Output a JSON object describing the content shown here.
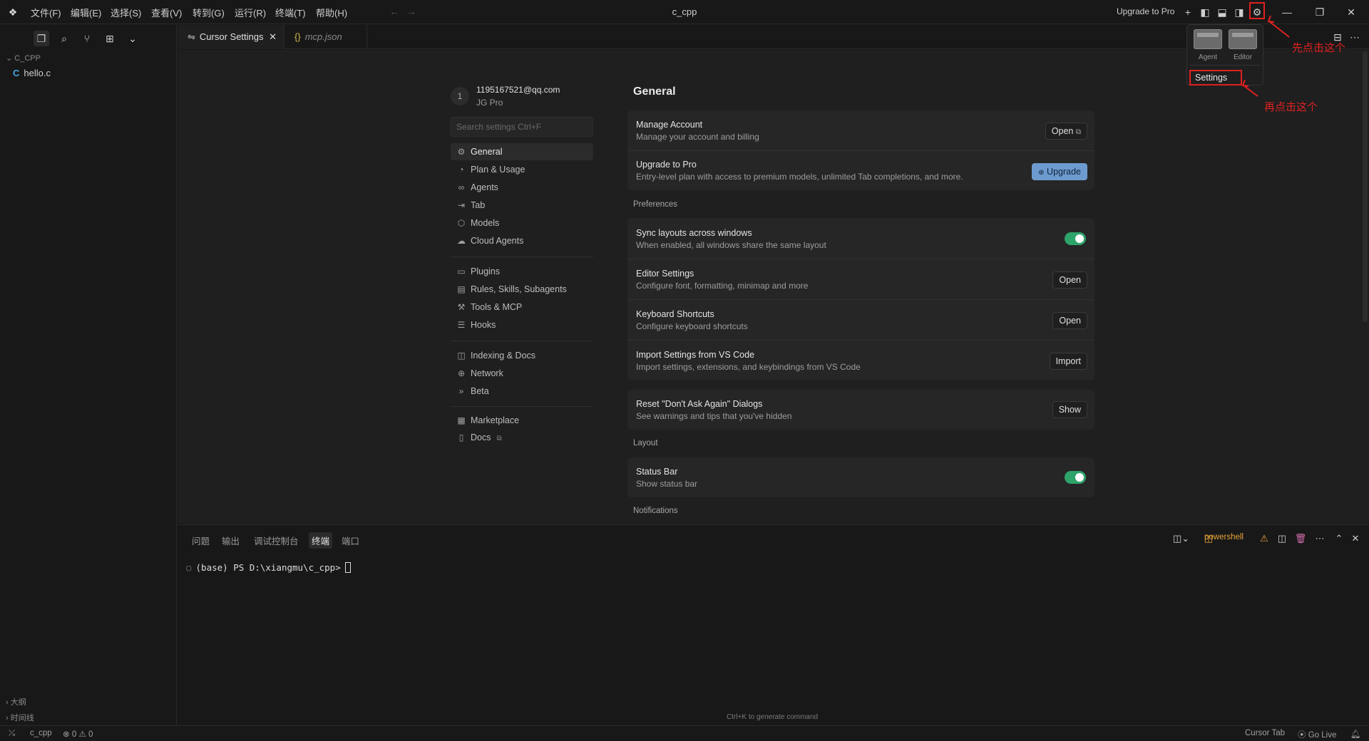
{
  "titlebar": {
    "menu": [
      "文件(F)",
      "编辑(E)",
      "选择(S)",
      "查看(V)",
      "转到(G)",
      "运行(R)",
      "终端(T)",
      "帮助(H)"
    ],
    "title": "c_cpp",
    "upgrade_label": "Upgrade to Pro"
  },
  "sidebar": {
    "root": "C_CPP",
    "files": [
      {
        "name": "hello.c",
        "icon": "C"
      }
    ],
    "bottom": [
      "大纲",
      "时间线"
    ]
  },
  "tabs": [
    {
      "label": "Cursor Settings",
      "icon": "settings-icon"
    },
    {
      "label": "mcp.json",
      "icon": "{}"
    }
  ],
  "settings": {
    "user": {
      "avatar": "1",
      "email": "1195167521@qq.com",
      "plan": "JG Pro"
    },
    "search_placeholder": "Search settings Ctrl+F",
    "nav": [
      {
        "label": "General",
        "icon": "⚙"
      },
      {
        "label": "Plan & Usage",
        "icon": "◔"
      },
      {
        "label": "Agents",
        "icon": "∞"
      },
      {
        "label": "Tab",
        "icon": "⇥"
      },
      {
        "label": "Models",
        "icon": "⬡"
      },
      {
        "label": "Cloud Agents",
        "icon": "☁"
      },
      {
        "label": "Plugins",
        "icon": "▭"
      },
      {
        "label": "Rules, Skills, Subagents",
        "icon": "▤"
      },
      {
        "label": "Tools & MCP",
        "icon": "⚒"
      },
      {
        "label": "Hooks",
        "icon": "☰"
      },
      {
        "label": "Indexing & Docs",
        "icon": "◫"
      },
      {
        "label": "Network",
        "icon": "⊕"
      },
      {
        "label": "Beta",
        "icon": "»"
      },
      {
        "label": "Marketplace",
        "icon": "▦"
      },
      {
        "label": "Docs",
        "icon": "▯"
      }
    ],
    "heading": "General",
    "account": [
      {
        "title": "Manage Account",
        "desc": "Manage your account and billing",
        "action": "Open"
      },
      {
        "title": "Upgrade to Pro",
        "desc": "Entry-level plan with access to premium models, unlimited Tab completions, and more.",
        "action": "Upgrade"
      }
    ],
    "preferences_label": "Preferences",
    "preferences": [
      {
        "title": "Sync layouts across windows",
        "desc": "When enabled, all windows share the same layout",
        "toggle": true
      },
      {
        "title": "Editor Settings",
        "desc": "Configure font, formatting, minimap and more",
        "action": "Open"
      },
      {
        "title": "Keyboard Shortcuts",
        "desc": "Configure keyboard shortcuts",
        "action": "Open"
      },
      {
        "title": "Import Settings from VS Code",
        "desc": "Import settings, extensions, and keybindings from VS Code",
        "action": "Import"
      }
    ],
    "reset": {
      "title": "Reset \"Don't Ask Again\" Dialogs",
      "desc": "See warnings and tips that you've hidden",
      "action": "Show"
    },
    "layout_label": "Layout",
    "layout": [
      {
        "title": "Status Bar",
        "desc": "Show status bar",
        "toggle": true
      }
    ],
    "notifications_label": "Notifications"
  },
  "panel": {
    "tabs": [
      "问题",
      "输出",
      "调试控制台",
      "终端",
      "端口"
    ],
    "active_tab": "终端",
    "shell": "powershell",
    "terminal_prompt": "(base) PS D:\\xiangmu\\c_cpp>",
    "hint": "Ctrl+K to generate command"
  },
  "statusbar": {
    "workspace": "c_cpp",
    "errors": "0",
    "warnings": "0",
    "cursor_tab": "Cursor Tab",
    "go_live": "Go Live"
  },
  "popup": {
    "layouts": [
      "Agent",
      "Editor"
    ],
    "settings_label": "Settings"
  },
  "annotations": {
    "first": "先点击这个",
    "second": "再点击这个",
    "color": "#e02020"
  }
}
